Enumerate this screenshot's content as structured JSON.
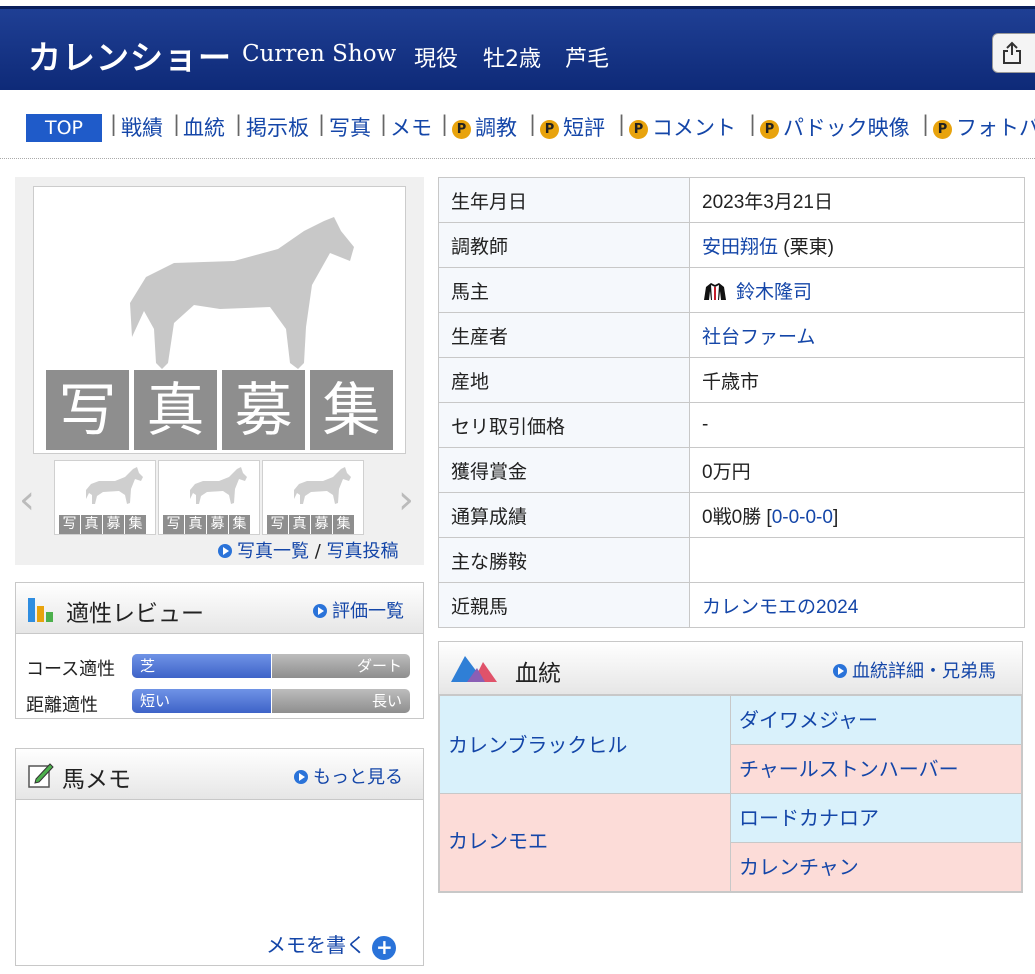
{
  "header": {
    "name": "カレンショー",
    "name_en": "Curren Show",
    "status": "現役",
    "sex_age": "牡2歳",
    "color": "芦毛"
  },
  "nav": {
    "top": "TOP",
    "items": [
      "戦績",
      "血統",
      "掲示板",
      "写真",
      "メモ"
    ],
    "premium_items": [
      "調教",
      "短評",
      "コメント",
      "パドック映像",
      "フォトパ"
    ],
    "premium_badge": "P"
  },
  "photo": {
    "main_caption": [
      "写",
      "真",
      "募",
      "集"
    ],
    "thumb_caption": [
      "写",
      "真",
      "募",
      "集"
    ],
    "link_list": "写真一覧",
    "link_sep": "/",
    "link_post": "写真投稿"
  },
  "aptitude": {
    "title": "適性レビュー",
    "link": "評価一覧",
    "rows": [
      {
        "label": "コース適性",
        "left": "芝",
        "right": "ダート",
        "value": 0.5
      },
      {
        "label": "距離適性",
        "left": "短い",
        "right": "長い",
        "value": 0.5
      }
    ]
  },
  "memo": {
    "title": "馬メモ",
    "link": "もっと見る",
    "write": "メモを書く"
  },
  "profile": {
    "birth_label": "生年月日",
    "birth": "2023年3月21日",
    "trainer_label": "調教師",
    "trainer": "安田翔伍",
    "trainer_region": "(栗東)",
    "owner_label": "馬主",
    "owner": "鈴木隆司",
    "breeder_label": "生産者",
    "breeder": "社台ファーム",
    "origin_label": "産地",
    "origin": "千歳市",
    "auction_label": "セリ取引価格",
    "auction": "-",
    "prize_label": "獲得賞金",
    "prize": "0万円",
    "record_label": "通算成績",
    "record": "0戦0勝",
    "record_detail": "0-0-0-0",
    "wins_label": "主な勝鞍",
    "wins": "",
    "relative_label": "近親馬",
    "relative": "カレンモエの2024"
  },
  "pedigree": {
    "title": "血統",
    "link": "血統詳細・兄弟馬",
    "sire": "カレンブラックヒル",
    "sire_sire": "ダイワメジャー",
    "sire_dam": "チャールストンハーバー",
    "dam": "カレンモエ",
    "dam_sire": "ロードカナロア",
    "dam_dam": "カレンチャン"
  },
  "colors": {
    "header": "#1f3f94",
    "link": "#1446a8",
    "sire_bg": "#d9f1fb",
    "dam_bg": "#fcdcd8",
    "badge": "#e8a30d"
  }
}
